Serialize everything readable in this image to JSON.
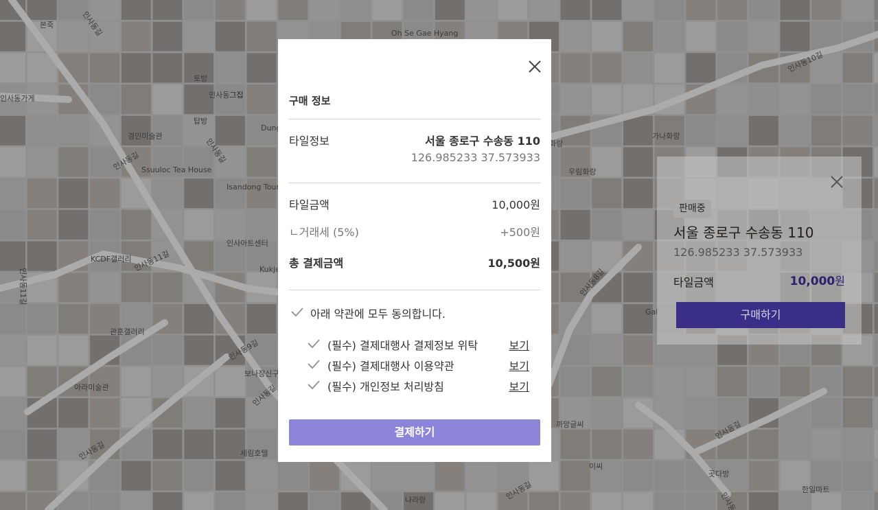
{
  "map": {
    "labels": [
      "본죽",
      "인사동길",
      "Oh Se Gae Hyang",
      "토방",
      "인사동그집",
      "그집",
      "인사동가게",
      "탑방",
      "경인미술관",
      "인사동길",
      "Ssuuloc Tea House",
      "Isandong Tourist Information",
      "Dung",
      "인사동길",
      "인사아트센터",
      "Kukje",
      "KCDF갤러리",
      "인사동11길",
      "인사동11길",
      "관훈갤러리",
      "인사동9길",
      "보나장신구",
      "인사동길",
      "아라미술관",
      "인사동길",
      "세림호텔",
      "나라랑",
      "인사동길",
      "인사동10길",
      "인사동8길",
      "우림화랑",
      "화랑",
      "가나화랑",
      "Gal",
      "인사동길",
      "까망글씨",
      "이씨",
      "곳다방",
      "한일마트",
      "인사동길"
    ]
  },
  "side_card": {
    "badge": "판매중",
    "title": "서울 종로구 수송동 110",
    "coords": "126.985233 37.573933",
    "price_label": "타일금액",
    "price_number": "10,000",
    "price_unit": "원",
    "buy_label": "구매하기"
  },
  "modal": {
    "heading": "구매 정보",
    "tile_info_label": "타일정보",
    "tile_address": "서울 종로구 수송동 110",
    "tile_coords": "126.985233 37.573933",
    "tile_price_label": "타일금액",
    "tile_price": "10,000원",
    "tax_label": "ㄴ거래세 (5%)",
    "tax_value": "+500원",
    "total_label": "총 결제금액",
    "total_value": "10,500원",
    "agree_all": "아래 약관에 모두 동의합니다.",
    "terms": [
      {
        "label": "(필수) 결제대행사 결제정보 위탁",
        "link": "보기"
      },
      {
        "label": "(필수) 결제대행사 이용약관",
        "link": "보기"
      },
      {
        "label": "(필수) 개인정보 처리방침",
        "link": "보기"
      }
    ],
    "pay_label": "결제하기"
  }
}
